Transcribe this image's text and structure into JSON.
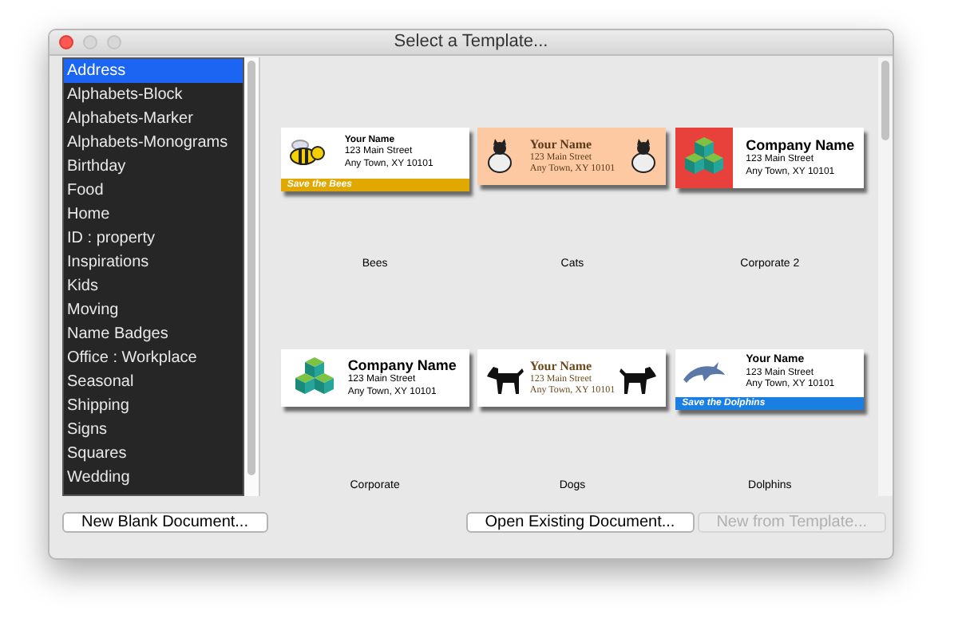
{
  "window": {
    "title": "Select a Template..."
  },
  "categories": [
    {
      "label": "Address",
      "selected": true
    },
    {
      "label": "Alphabets-Block",
      "selected": false
    },
    {
      "label": "Alphabets-Marker",
      "selected": false
    },
    {
      "label": "Alphabets-Monograms",
      "selected": false
    },
    {
      "label": "Birthday",
      "selected": false
    },
    {
      "label": "Food",
      "selected": false
    },
    {
      "label": "Home",
      "selected": false
    },
    {
      "label": "ID : property",
      "selected": false
    },
    {
      "label": "Inspirations",
      "selected": false
    },
    {
      "label": "Kids",
      "selected": false
    },
    {
      "label": "Moving",
      "selected": false
    },
    {
      "label": "Name Badges",
      "selected": false
    },
    {
      "label": "Office : Workplace",
      "selected": false
    },
    {
      "label": "Seasonal",
      "selected": false
    },
    {
      "label": "Shipping",
      "selected": false
    },
    {
      "label": "Signs",
      "selected": false
    },
    {
      "label": "Squares",
      "selected": false
    },
    {
      "label": "Wedding",
      "selected": false
    }
  ],
  "templates": [
    {
      "kind": "bees",
      "name": "Bees",
      "line_1": "Your Name",
      "line_2": "123 Main Street",
      "line_3": "Any Town, XY 10101",
      "banner": "Save the Bees"
    },
    {
      "kind": "cats",
      "name": "Cats",
      "line_1": "Your Name",
      "line_2": "123 Main Street",
      "line_3": "Any Town, XY 10101"
    },
    {
      "kind": "corporate2",
      "name": "Corporate 2",
      "line_1": "Company Name",
      "line_2": "123 Main Street",
      "line_3": "Any Town, XY 10101"
    },
    {
      "kind": "corporate",
      "name": "Corporate",
      "line_1": "Company Name",
      "line_2": "123 Main Street",
      "line_3": "Any Town, XY 10101"
    },
    {
      "kind": "dogs",
      "name": "Dogs",
      "line_1": "Your Name",
      "line_2": "123 Main Street",
      "line_3": "Any Town, XY 10101"
    },
    {
      "kind": "dolphins",
      "name": "Dolphins",
      "line_1": "Your Name",
      "line_2": "123 Main Street",
      "line_3": "Any Town, XY 10101",
      "banner": "Save the Dolphins"
    }
  ],
  "buttons": [
    {
      "label": "New Blank Document...",
      "disabled": false
    },
    {
      "label": "Open Existing Document...",
      "disabled": false
    },
    {
      "label": "New from Template...",
      "disabled": true
    }
  ]
}
